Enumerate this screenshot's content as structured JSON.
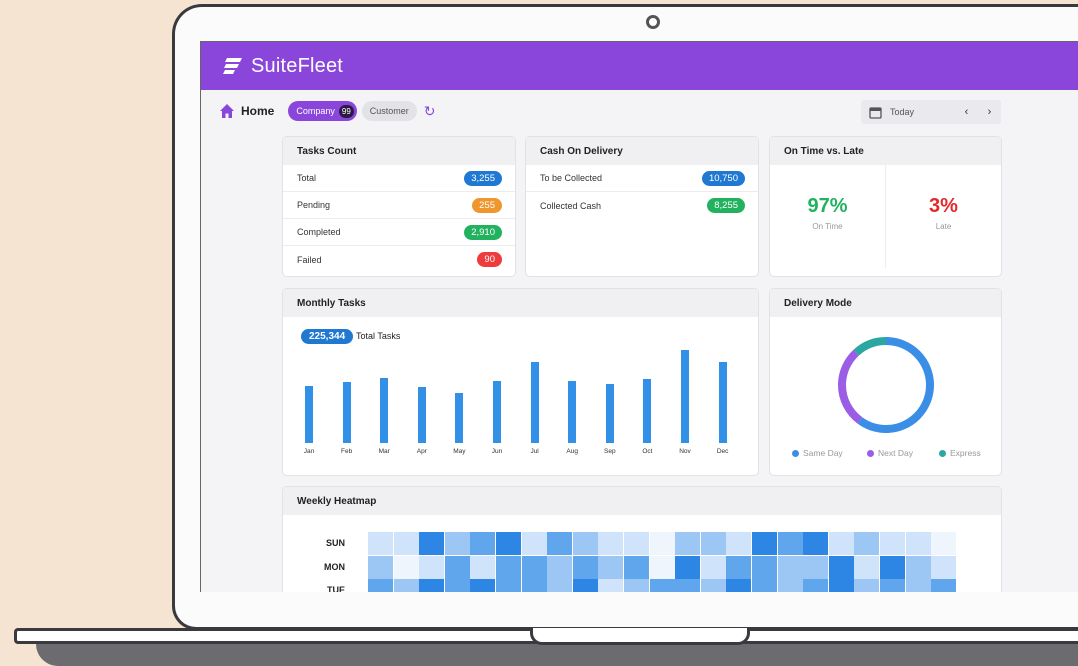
{
  "app": {
    "name": "SuiteFleet"
  },
  "toolbar": {
    "home_label": "Home",
    "company_label": "Company",
    "company_count": "99",
    "customer_label": "Customer",
    "date_label": "Today",
    "prev_label": "‹",
    "next_label": "›"
  },
  "tasks_count": {
    "title": "Tasks Count",
    "rows": [
      {
        "label": "Total",
        "value": "3,255",
        "color": "#1f78d1"
      },
      {
        "label": "Pending",
        "value": "255",
        "color": "#f0962e"
      },
      {
        "label": "Completed",
        "value": "2,910",
        "color": "#22b25f"
      },
      {
        "label": "Failed",
        "value": "90",
        "color": "#ee3b3b"
      }
    ]
  },
  "cod": {
    "title": "Cash On Delivery",
    "rows": [
      {
        "label": "To be Collected",
        "value": "10,750",
        "color": "#1f78d1"
      },
      {
        "label": "Collected Cash",
        "value": "8,255",
        "color": "#22b25f"
      }
    ]
  },
  "on_time": {
    "title": "On Time vs. Late",
    "on_time_pct": "97%",
    "on_time_label": "On Time",
    "late_pct": "3%",
    "late_label": "Late",
    "on_time_color": "#22b25f",
    "late_color": "#e12b2b"
  },
  "monthly": {
    "title": "Monthly Tasks",
    "total_value": "225,344",
    "total_label": "Total Tasks"
  },
  "chart_data": {
    "type": "bar",
    "categories": [
      "Jan",
      "Feb",
      "Mar",
      "Apr",
      "May",
      "Jun",
      "Jul",
      "Aug",
      "Sep",
      "Oct",
      "Nov",
      "Dec"
    ],
    "values": [
      54,
      58,
      62,
      53,
      48,
      59,
      77,
      59,
      56,
      61,
      89,
      77
    ],
    "ylim": [
      0,
      100
    ],
    "color": "#3290e6"
  },
  "delivery_mode": {
    "title": "Delivery Mode",
    "segments": [
      {
        "name": "Same Day",
        "fraction": 0.6,
        "color": "#3a8ee6"
      },
      {
        "name": "Next Day",
        "fraction": 0.28,
        "color": "#9b5de5"
      },
      {
        "name": "Express",
        "fraction": 0.12,
        "color": "#2aa7a0"
      }
    ]
  },
  "heatmap": {
    "title": "Weekly Heatmap",
    "days": [
      "SUN",
      "MON",
      "TUE"
    ],
    "levels": [
      [
        1,
        1,
        4,
        2,
        3,
        4,
        1,
        3,
        2,
        1,
        1,
        0,
        2,
        2,
        1,
        4,
        3,
        4,
        1,
        2,
        1,
        1,
        0
      ],
      [
        2,
        0,
        1,
        3,
        1,
        3,
        3,
        2,
        3,
        2,
        3,
        0,
        4,
        1,
        3,
        3,
        2,
        2,
        4,
        1,
        4,
        2,
        1
      ],
      [
        3,
        2,
        4,
        3,
        4,
        3,
        3,
        2,
        4,
        1,
        2,
        3,
        3,
        2,
        4,
        3,
        2,
        3,
        4,
        2,
        3,
        2,
        3
      ]
    ],
    "palette": [
      "#eef5fd",
      "#cfe3fa",
      "#9cc7f4",
      "#5fa6ec",
      "#2e86e4"
    ]
  }
}
